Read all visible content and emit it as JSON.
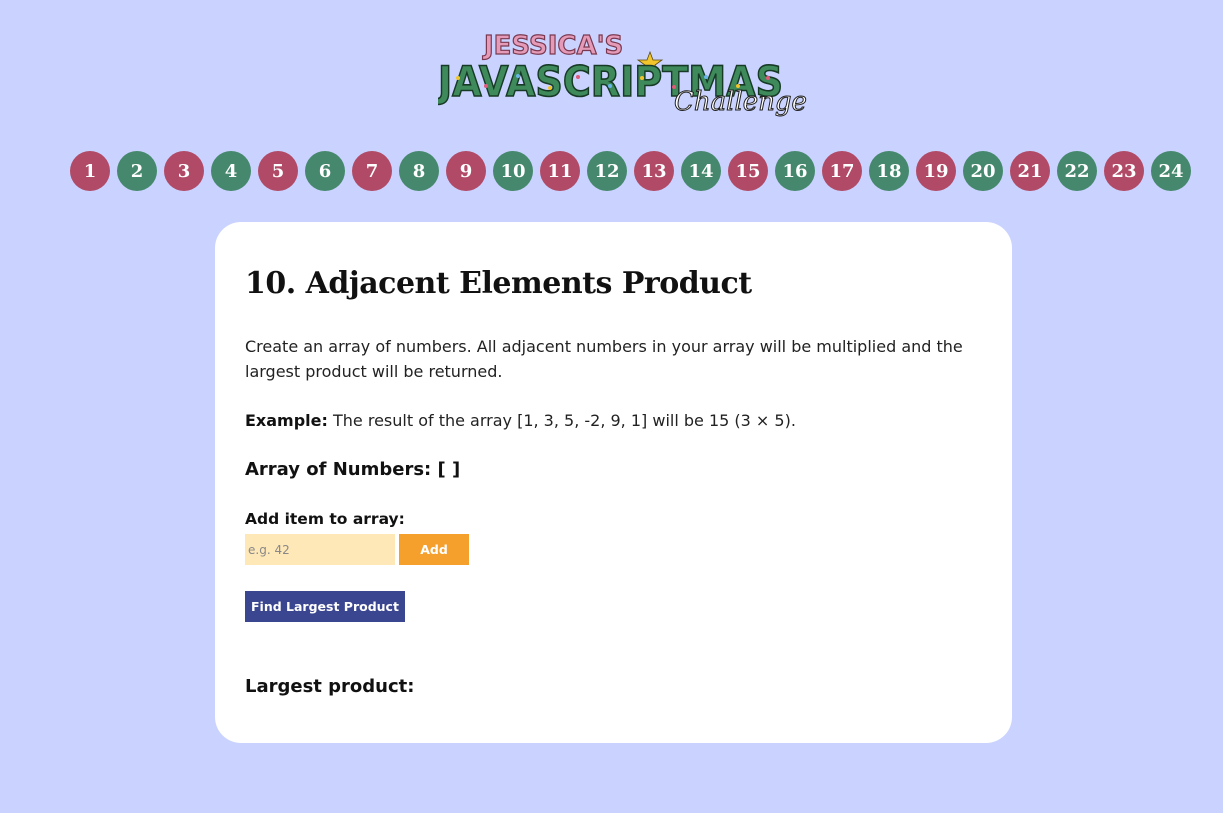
{
  "logo": {
    "line1": "JESSICA'S",
    "line2": "JAVASCRIPTMAS",
    "line3": "Challenge"
  },
  "days": [
    {
      "label": "1",
      "color": "red"
    },
    {
      "label": "2",
      "color": "green"
    },
    {
      "label": "3",
      "color": "red"
    },
    {
      "label": "4",
      "color": "green"
    },
    {
      "label": "5",
      "color": "red"
    },
    {
      "label": "6",
      "color": "green"
    },
    {
      "label": "7",
      "color": "red"
    },
    {
      "label": "8",
      "color": "green"
    },
    {
      "label": "9",
      "color": "red"
    },
    {
      "label": "10",
      "color": "green"
    },
    {
      "label": "11",
      "color": "red"
    },
    {
      "label": "12",
      "color": "green"
    },
    {
      "label": "13",
      "color": "red"
    },
    {
      "label": "14",
      "color": "green"
    },
    {
      "label": "15",
      "color": "red"
    },
    {
      "label": "16",
      "color": "green"
    },
    {
      "label": "17",
      "color": "red"
    },
    {
      "label": "18",
      "color": "green"
    },
    {
      "label": "19",
      "color": "red"
    },
    {
      "label": "20",
      "color": "green"
    },
    {
      "label": "21",
      "color": "red"
    },
    {
      "label": "22",
      "color": "green"
    },
    {
      "label": "23",
      "color": "red"
    },
    {
      "label": "24",
      "color": "green"
    }
  ],
  "colors": {
    "background": "#cad3ff",
    "day_red": "#b04a66",
    "day_green": "#46886d",
    "input_bg": "#ffe8b8",
    "add_button": "#f5a02c",
    "find_button": "#3b4690"
  },
  "challenge": {
    "title": "10. Adjacent Elements Product",
    "description": "Create an array of numbers. All adjacent numbers in your array will be multiplied and the largest product will be returned.",
    "example_label": "Example:",
    "example_text": " The result of the array [1, 3, 5, -2, 9, 1] will be 15 (3 × 5).",
    "array_heading": "Array of Numbers: [ ]",
    "add_label": "Add item to array:",
    "input_value": "",
    "input_placeholder": "e.g. 42",
    "add_button": "Add",
    "find_button": "Find Largest Product",
    "result_label": "Largest product:"
  }
}
